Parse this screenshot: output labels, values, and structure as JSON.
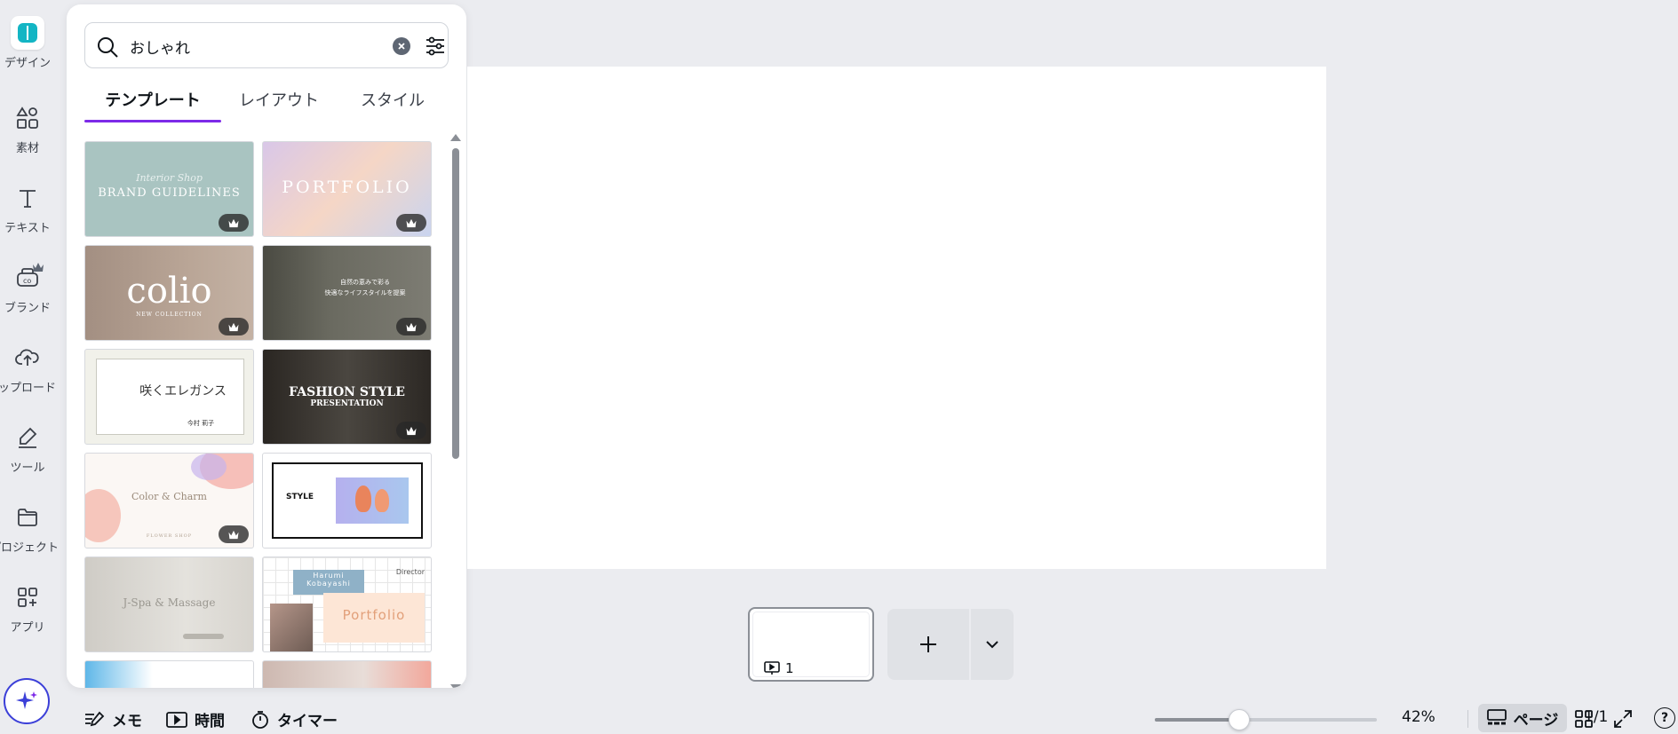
{
  "rail": {
    "items": [
      {
        "label": "デザイン"
      },
      {
        "label": "素材"
      },
      {
        "label": "テキスト"
      },
      {
        "label": "ブランド"
      },
      {
        "label": "アップロード"
      },
      {
        "label": "ツール"
      },
      {
        "label": "プロジェクト"
      },
      {
        "label": "アプリ"
      }
    ]
  },
  "search": {
    "value": "おしゃれ"
  },
  "tabs": [
    {
      "label": "テンプレート",
      "active": true
    },
    {
      "label": "レイアウト",
      "active": false
    },
    {
      "label": "スタイル",
      "active": false
    }
  ],
  "templates": [
    {
      "line1": "Interior Shop",
      "line2": "BRAND GUIDELINES",
      "premium": true
    },
    {
      "line1": "PORTFOLIO",
      "premium": true
    },
    {
      "line1": "colio",
      "line2": "NEW COLLECTION",
      "premium": true
    },
    {
      "line1": "自然の恵みで彩る",
      "line2": "快適なライフスタイルを提案",
      "premium": true
    },
    {
      "line1": "咲くエレガンス",
      "line2": "今村 莉子",
      "premium": false
    },
    {
      "line1": "FASHION STYLE",
      "line2": "PRESENTATION",
      "premium": true
    },
    {
      "line1": "Color & Charm",
      "line2": "FLOWER SHOP",
      "premium": true
    },
    {
      "line1": "STYLE",
      "premium": false
    },
    {
      "line1": "J-Spa & Massage",
      "premium": false
    },
    {
      "line1": "Harumi Kobayashi",
      "line2": "Portfolio",
      "line3": "Director",
      "premium": false
    }
  ],
  "canvas": {
    "page_number": "1"
  },
  "bottombar": {
    "notes": "メモ",
    "timing": "時間",
    "timer": "タイマー",
    "zoom": "42%",
    "zoom_level": 0.38,
    "pages": "ページ",
    "page_count": "1/1",
    "help": "?"
  },
  "colors": {
    "accent": "#7d2ae8",
    "brand_teal": "#13b5c4",
    "magic": "#3b3fd8"
  }
}
